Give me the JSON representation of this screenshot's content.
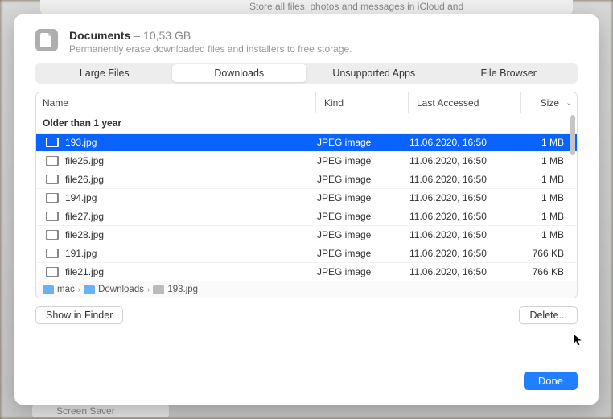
{
  "bg": {
    "top_hint": "Store all files, photos and messages in iCloud and",
    "bottom_hint": "Screen Saver"
  },
  "header": {
    "title": "Documents",
    "size": "10,53 GB",
    "subtitle": "Permanently erase downloaded files and installers to free storage."
  },
  "tabs": {
    "items": [
      "Large Files",
      "Downloads",
      "Unsupported Apps",
      "File Browser"
    ],
    "active_index": 1
  },
  "columns": {
    "name": "Name",
    "kind": "Kind",
    "last_accessed": "Last Accessed",
    "size": "Size"
  },
  "group_label": "Older than 1 year",
  "files": [
    {
      "name": "193.jpg",
      "kind": "JPEG image",
      "date": "11.06.2020, 16:50",
      "size": "1 MB",
      "selected": true
    },
    {
      "name": "file25.jpg",
      "kind": "JPEG image",
      "date": "11.06.2020, 16:50",
      "size": "1 MB",
      "selected": false
    },
    {
      "name": "file26.jpg",
      "kind": "JPEG image",
      "date": "11.06.2020, 16:50",
      "size": "1 MB",
      "selected": false
    },
    {
      "name": "194.jpg",
      "kind": "JPEG image",
      "date": "11.06.2020, 16:50",
      "size": "1 MB",
      "selected": false
    },
    {
      "name": "file27.jpg",
      "kind": "JPEG image",
      "date": "11.06.2020, 16:50",
      "size": "1 MB",
      "selected": false
    },
    {
      "name": "file28.jpg",
      "kind": "JPEG image",
      "date": "11.06.2020, 16:50",
      "size": "1 MB",
      "selected": false
    },
    {
      "name": "191.jpg",
      "kind": "JPEG image",
      "date": "11.06.2020, 16:50",
      "size": "766 KB",
      "selected": false
    },
    {
      "name": "file21.jpg",
      "kind": "JPEG image",
      "date": "11.06.2020, 16:50",
      "size": "766 KB",
      "selected": false
    }
  ],
  "breadcrumb": {
    "items": [
      "mac",
      "Downloads",
      "193.jpg"
    ]
  },
  "actions": {
    "show_in_finder": "Show in Finder",
    "delete": "Delete...",
    "done": "Done"
  }
}
